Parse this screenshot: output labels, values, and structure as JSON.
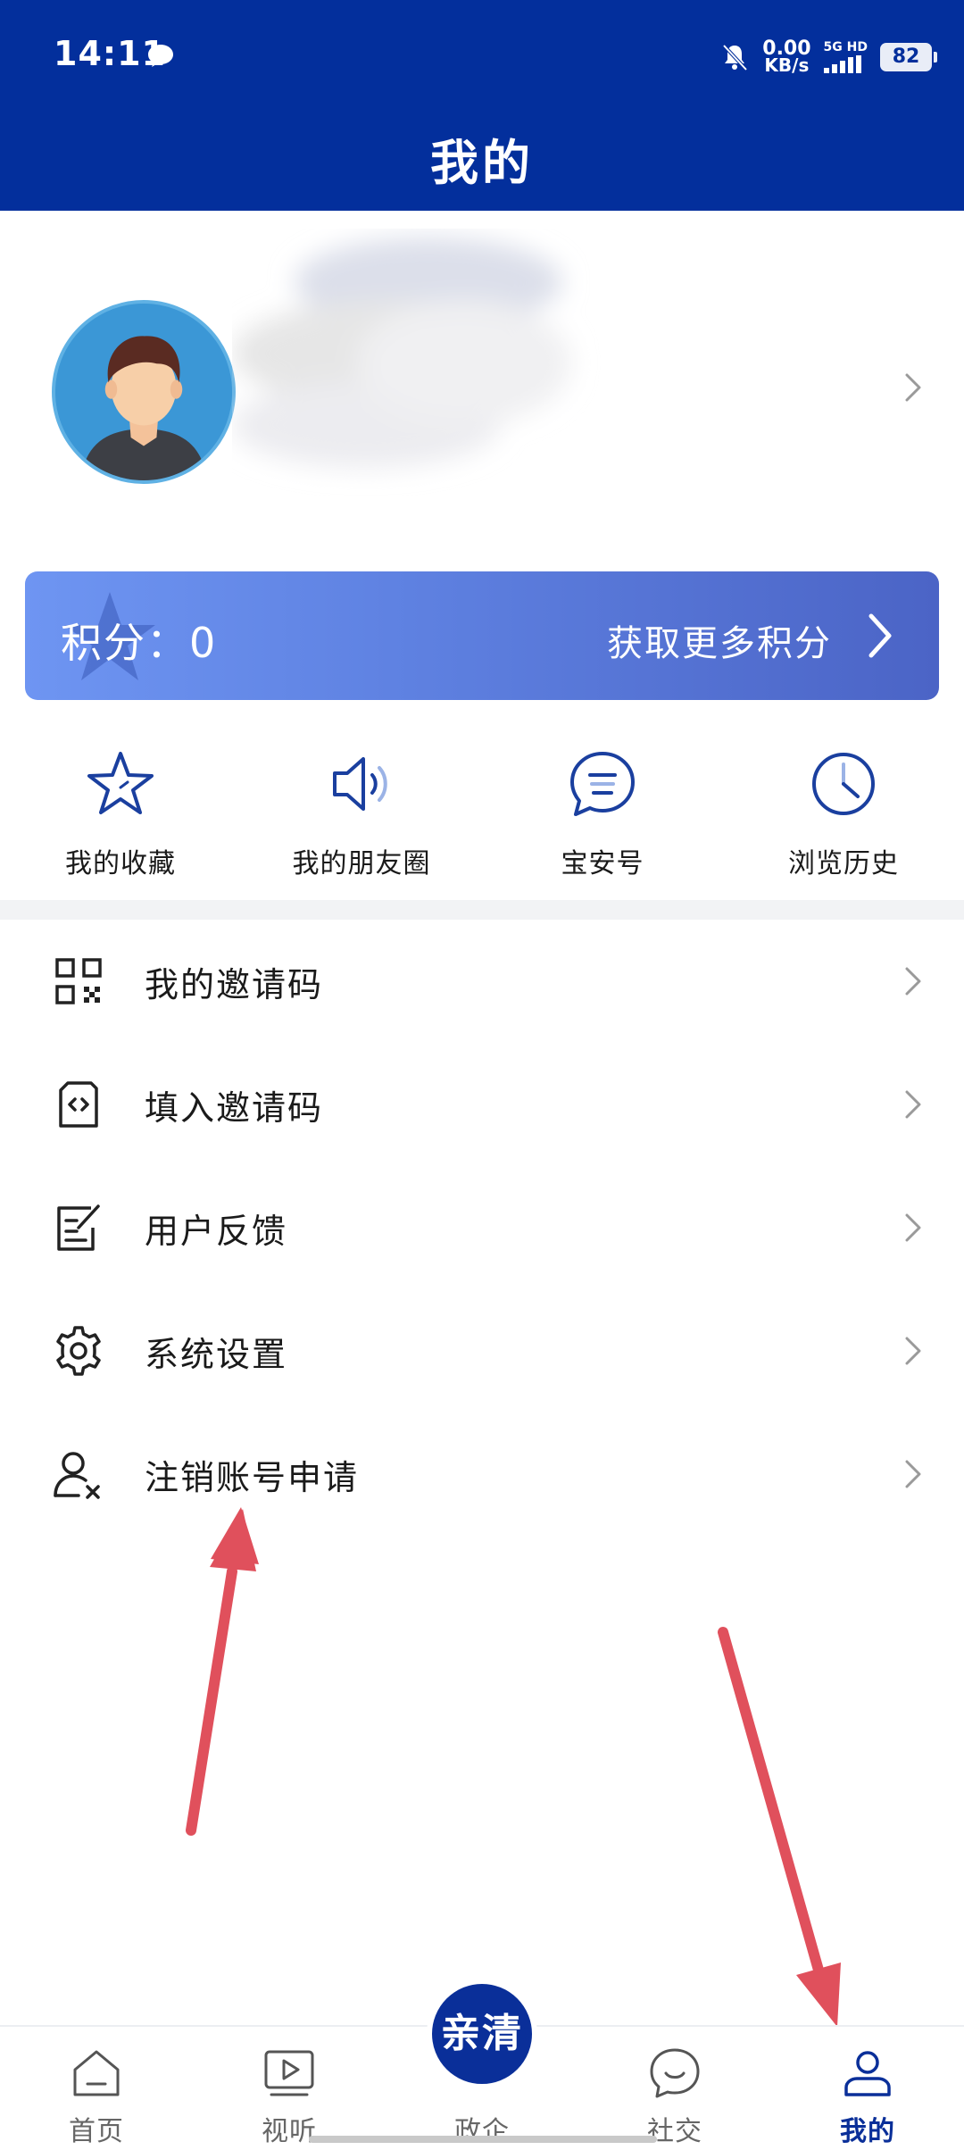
{
  "status_bar": {
    "time": "14:11",
    "net_speed_value": "0.00",
    "net_speed_unit": "KB/s",
    "network_label": "5G HD",
    "battery": "82",
    "icons": [
      "chat-bubble-icon",
      "mute-bell-icon",
      "signal-icon",
      "battery-icon"
    ]
  },
  "header": {
    "title": "我的"
  },
  "profile": {
    "name_obscured": true,
    "avatar_icon": "user-avatar-icon"
  },
  "points": {
    "label": "积分：0",
    "more_label": "获取更多积分"
  },
  "quick_actions": [
    {
      "label": "我的收藏",
      "icon": "star-icon"
    },
    {
      "label": "我的朋友圈",
      "icon": "speaker-icon"
    },
    {
      "label": "宝安号",
      "icon": "message-circle-icon"
    },
    {
      "label": "浏览历史",
      "icon": "clock-icon"
    }
  ],
  "menu": [
    {
      "label": "我的邀请码",
      "icon": "qr-code-icon"
    },
    {
      "label": "填入邀请码",
      "icon": "code-document-icon"
    },
    {
      "label": "用户反馈",
      "icon": "feedback-edit-icon"
    },
    {
      "label": "系统设置",
      "icon": "gear-icon"
    },
    {
      "label": "注销账号申请",
      "icon": "user-remove-icon"
    }
  ],
  "bottom_nav": {
    "items": [
      {
        "label": "首页",
        "icon": "home-icon"
      },
      {
        "label": "视听",
        "icon": "play-icon"
      },
      {
        "label": "政企",
        "icon": "qinqing-logo"
      },
      {
        "label": "社交",
        "icon": "chat-icon"
      },
      {
        "label": "我的",
        "icon": "user-icon",
        "active": true
      }
    ],
    "center_logo_text": "亲清"
  },
  "colors": {
    "primary": "#032f9c",
    "nav_active": "#0a2f99",
    "icon_blue": "#1a3f9f",
    "banner_start": "#6e95f2",
    "banner_end": "#4b64c6",
    "annotation_arrow": "#e0505c"
  }
}
